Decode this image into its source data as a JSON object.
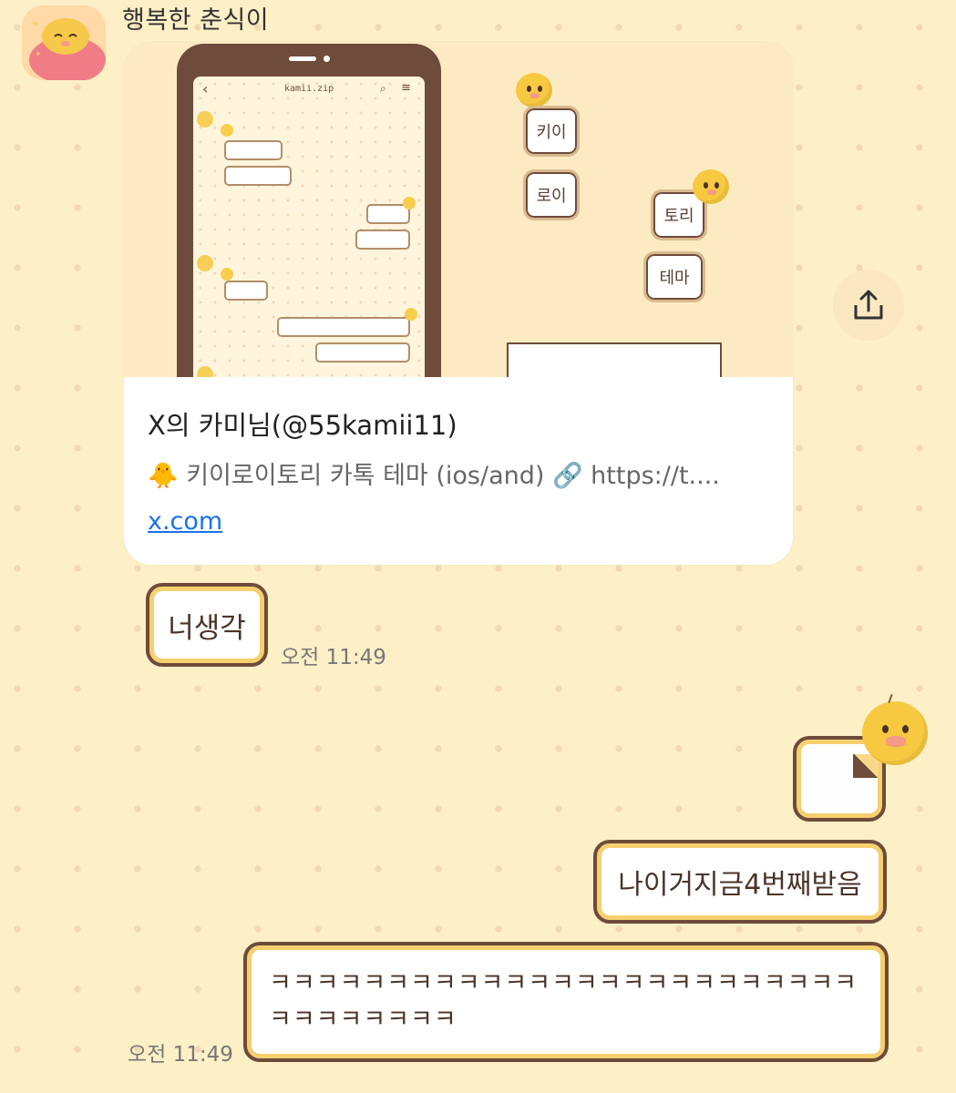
{
  "sender": {
    "name": "행복한 춘식이",
    "avatar_icon": "sleeping-character-avatar"
  },
  "link_preview": {
    "image": {
      "phone_title": "kamii.zip",
      "theme_buttons": [
        "키이",
        "로이",
        "토리",
        "테마"
      ]
    },
    "title": "X의 카미님(@55kamii11)",
    "description": "🐥 키이로이토리 카톡 테마 (ios/and) 🔗 https://t....",
    "domain": "x.com"
  },
  "share_button": {
    "icon": "share-icon"
  },
  "messages": [
    {
      "side": "left",
      "text": "너생각",
      "time": "오전 11:49"
    },
    {
      "side": "right",
      "type": "image",
      "icon": "image-sticker"
    },
    {
      "side": "right",
      "text": "나이거지금4번째받음"
    },
    {
      "side": "right",
      "text": "ㅋㅋㅋㅋㅋㅋㅋㅋㅋㅋㅋㅋㅋㅋㅋㅋㅋㅋㅋㅋㅋㅋㅋㅋㅋㅋㅋㅋㅋㅋㅋㅋㅋ",
      "time": "오전 11:49"
    }
  ],
  "colors": {
    "background": "#fdefc6",
    "bubble_border": "#6e4b3a",
    "bubble_inner_border": "#f6cf6e",
    "link": "#1a73e8"
  }
}
